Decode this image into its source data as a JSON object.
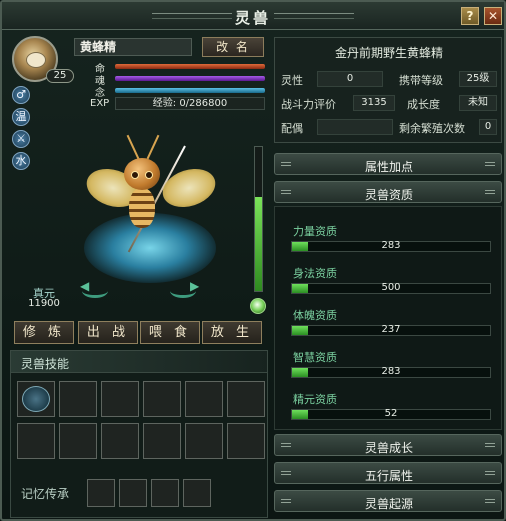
{
  "window": {
    "title": "灵兽",
    "help_label": "?",
    "close_label": "✕"
  },
  "pet": {
    "name": "黄蜂精",
    "level": "25",
    "rename_label": "改 名",
    "stats": [
      {
        "label": "命",
        "color": "#c84a2a"
      },
      {
        "label": "魂",
        "color": "#8a3ad0"
      },
      {
        "label": "念",
        "color": "#3aa0c8"
      }
    ],
    "exp_label": "EXP",
    "exp_text": "经验: 0/286800",
    "side_icons": [
      "♂",
      "温",
      "⚔",
      "水"
    ],
    "zhenyuan_label": "真元",
    "zhenyuan_value": "11900",
    "gauge_level": 0.65,
    "actions": [
      "修 炼",
      "出 战",
      "喂 食",
      "放 生"
    ]
  },
  "skills": {
    "title": "灵兽技能",
    "memory_label": "记忆传承"
  },
  "info": {
    "title": "金丹前期野生黄蜂精",
    "lingxing_label": "灵性",
    "lingxing_value": "0",
    "carry_label": "携带等级",
    "carry_value": "25级",
    "power_label": "战斗力评价",
    "power_value": "3135",
    "growth_label": "成长度",
    "growth_value": "未知",
    "mate_label": "配偶",
    "mate_value": "",
    "breed_label": "剩余繁殖次数",
    "breed_value": "0"
  },
  "sections": {
    "attr_bonus": "属性加点",
    "aptitude": "灵兽资质",
    "growth": "灵兽成长",
    "elements": "五行属性",
    "origin": "灵兽起源"
  },
  "aptitudes": [
    {
      "label": "力量资质",
      "value": "283",
      "fill": 0.08
    },
    {
      "label": "身法资质",
      "value": "500",
      "fill": 0.08
    },
    {
      "label": "体魄资质",
      "value": "237",
      "fill": 0.08
    },
    {
      "label": "智慧资质",
      "value": "283",
      "fill": 0.08
    },
    {
      "label": "精元资质",
      "value": "52",
      "fill": 0.08
    }
  ],
  "colors": {
    "accent": "#7bd1a0",
    "bar_green": "#4fc23a",
    "frame": "#4c5b52"
  }
}
